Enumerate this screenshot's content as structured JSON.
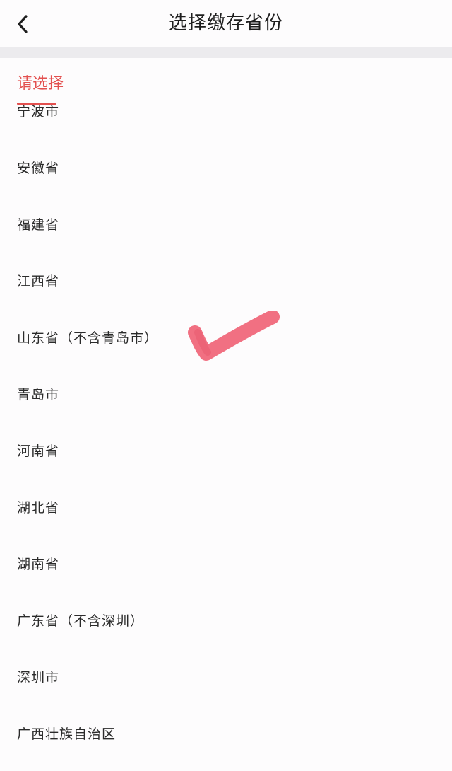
{
  "header": {
    "title": "选择缴存省份",
    "back_icon": "chevron-left-icon"
  },
  "tabs": [
    {
      "label": "请选择",
      "active": true
    }
  ],
  "colors": {
    "accent": "#e3504f",
    "check_mark": "#f06477",
    "divider_band": "#ecebee"
  },
  "provinces": [
    {
      "label": "宁波市"
    },
    {
      "label": "安徽省"
    },
    {
      "label": "福建省"
    },
    {
      "label": "江西省"
    },
    {
      "label": "山东省（不含青岛市）"
    },
    {
      "label": "青岛市"
    },
    {
      "label": "河南省"
    },
    {
      "label": "湖北省"
    },
    {
      "label": "湖南省"
    },
    {
      "label": "广东省（不含深圳）"
    },
    {
      "label": "深圳市"
    },
    {
      "label": "广西壮族自治区"
    }
  ],
  "annotation": {
    "icon": "check-mark-icon",
    "marks_item": "山东省（不含青岛市）"
  }
}
